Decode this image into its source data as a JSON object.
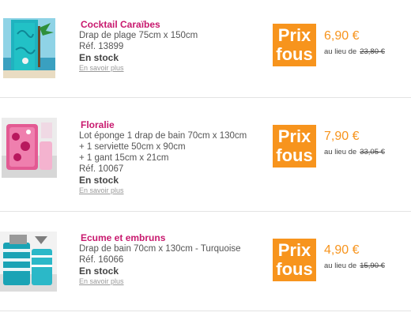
{
  "products": [
    {
      "name": "Cocktail Caraïbes",
      "desc": [
        "Drap de plage 75cm x 150cm",
        "Réf. 13899"
      ],
      "stock": "En stock",
      "more": "En savoir plus",
      "badge": [
        "Prix",
        "fous"
      ],
      "price": "6,90 €",
      "was_label": "au lieu de",
      "old_price": "23,80 €"
    },
    {
      "name": "Floralie",
      "desc": [
        "Lot éponge 1 drap de bain 70cm x 130cm",
        "+ 1 serviette 50cm x 90cm",
        "+ 1 gant 15cm x 21cm",
        "Réf. 10067"
      ],
      "stock": "En stock",
      "more": "En savoir plus",
      "badge": [
        "Prix",
        "fous"
      ],
      "price": "7,90 €",
      "was_label": "au lieu de",
      "old_price": "33,05 €"
    },
    {
      "name": "Ecume et embruns",
      "desc": [
        "Drap de bain 70cm x 130cm - Turquoise",
        "Réf. 16066"
      ],
      "stock": "En stock",
      "more": "En savoir plus",
      "badge": [
        "Prix",
        "fous"
      ],
      "price": "4,90 €",
      "was_label": "au lieu de",
      "old_price": "15,90 €"
    }
  ],
  "colors": {
    "name": "#c8196e",
    "accent": "#f7941d",
    "separator": "#e3e3e3"
  }
}
